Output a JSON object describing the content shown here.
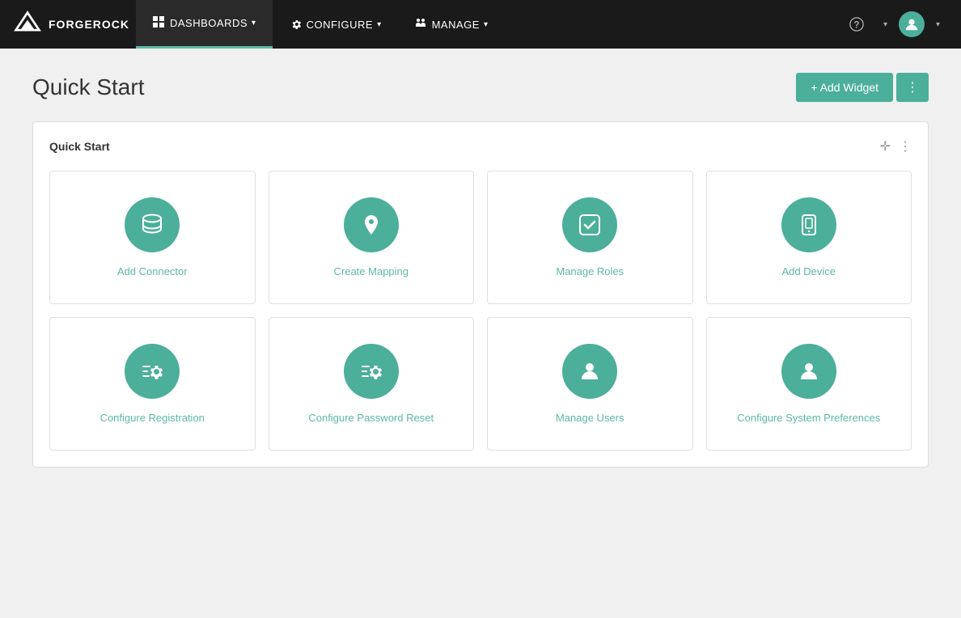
{
  "brand": {
    "name": "FORGEROCK"
  },
  "navbar": {
    "items": [
      {
        "id": "dashboards",
        "label": "DASHBOARDS",
        "icon": "grid",
        "active": true
      },
      {
        "id": "configure",
        "label": "CONFIGURE",
        "icon": "wrench",
        "active": false
      },
      {
        "id": "manage",
        "label": "MANAGE",
        "icon": "cogs",
        "active": false
      }
    ]
  },
  "page": {
    "title": "Quick Start",
    "add_widget_label": "+ Add Widget"
  },
  "widget": {
    "title": "Quick Start",
    "items": [
      {
        "id": "add-connector",
        "label": "Add Connector",
        "icon": "database"
      },
      {
        "id": "create-mapping",
        "label": "Create Mapping",
        "icon": "location"
      },
      {
        "id": "manage-roles",
        "label": "Manage Roles",
        "icon": "check-badge"
      },
      {
        "id": "add-device",
        "label": "Add Device",
        "icon": "device"
      },
      {
        "id": "configure-registration",
        "label": "Configure Registration",
        "icon": "gear"
      },
      {
        "id": "configure-password-reset",
        "label": "Configure Password Reset",
        "icon": "gear2"
      },
      {
        "id": "manage-users",
        "label": "Manage Users",
        "icon": "person"
      },
      {
        "id": "configure-system-preferences",
        "label": "Configure System Preferences",
        "icon": "person2"
      }
    ]
  }
}
